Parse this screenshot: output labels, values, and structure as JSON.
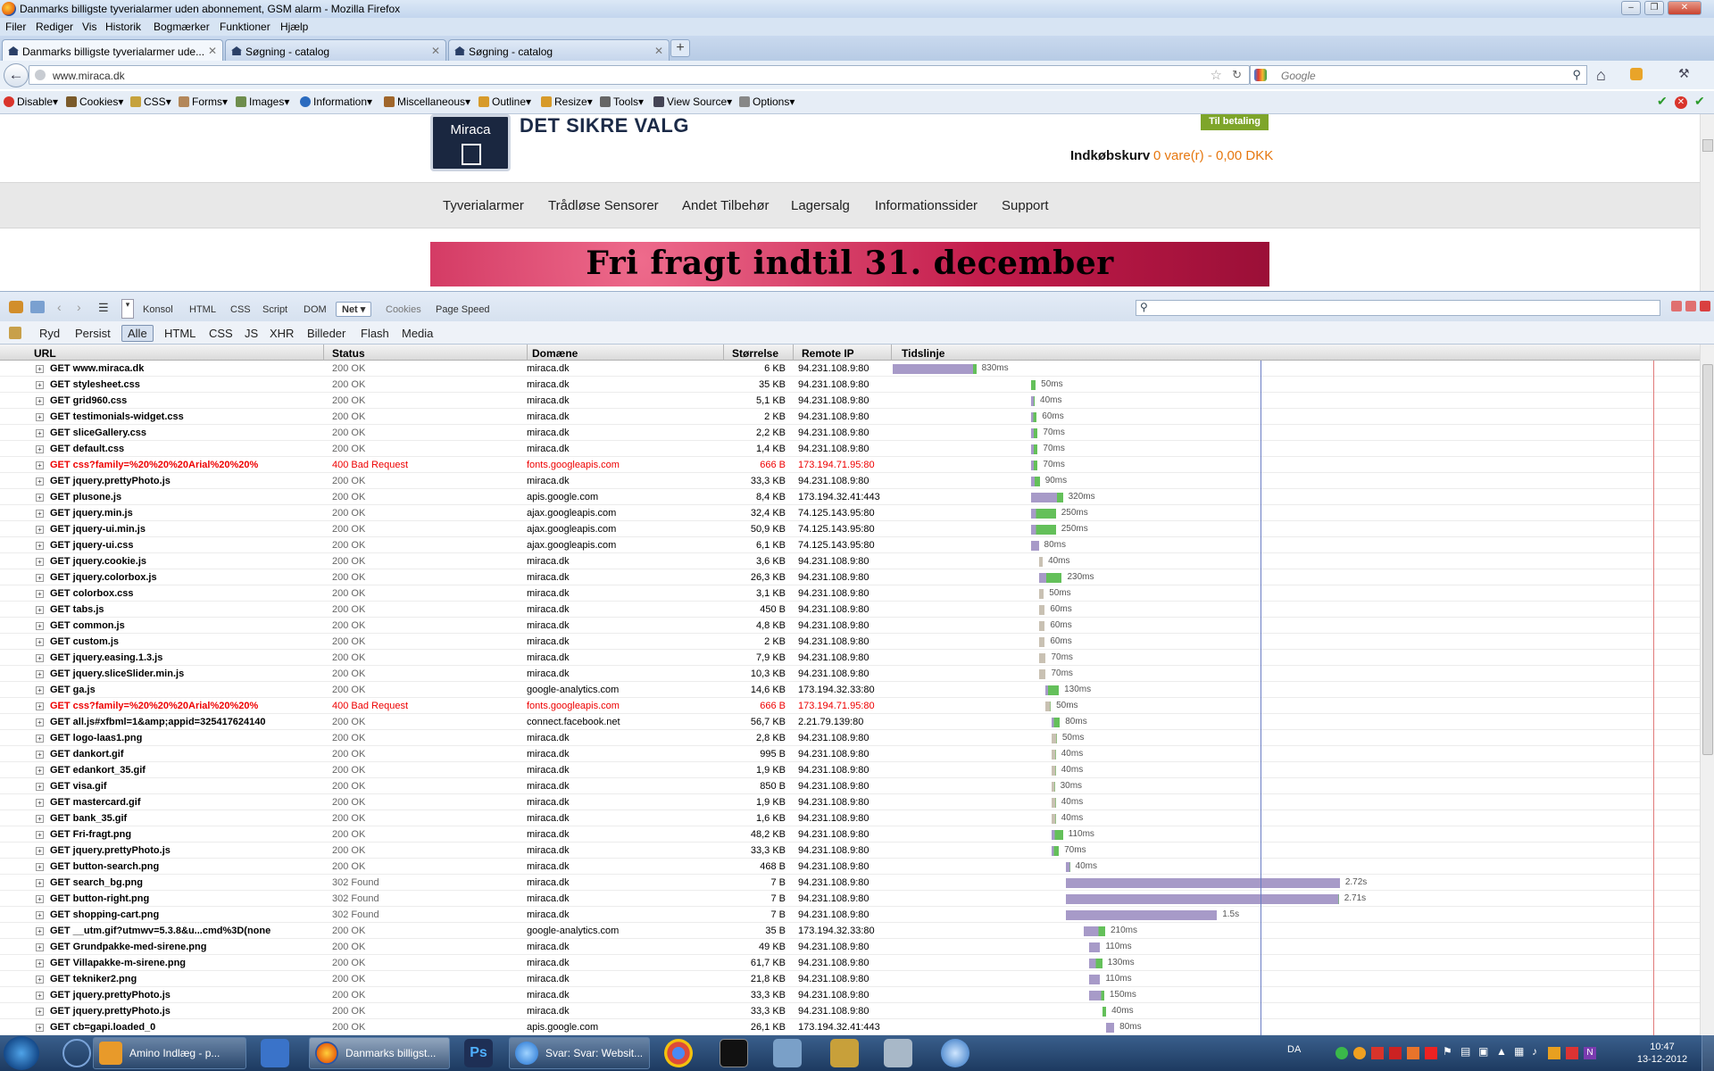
{
  "window": {
    "title": "Danmarks billigste tyverialarmer uden abonnement, GSM alarm - Mozilla Firefox"
  },
  "menu": [
    "Filer",
    "Rediger",
    "Vis",
    "Historik",
    "Bogmærker",
    "Funktioner",
    "Hjælp"
  ],
  "tabs": [
    {
      "label": "Danmarks billigste tyverialarmer ude..."
    },
    {
      "label": "Søgning - catalog"
    },
    {
      "label": "Søgning - catalog"
    }
  ],
  "nav": {
    "url": "www.miraca.dk",
    "search_placeholder": "Google"
  },
  "webdev": [
    "Disable",
    "Cookies",
    "CSS",
    "Forms",
    "Images",
    "Information",
    "Miscellaneous",
    "Outline",
    "Resize",
    "Tools",
    "View Source",
    "Options"
  ],
  "site": {
    "logo_text": "Miraca",
    "slogan": "DET SIKRE VALG",
    "pay_button": "Til betaling",
    "cart_label": "Indkøbskurv",
    "cart_value": "0 vare(r) - 0,00 DKK",
    "menu": [
      "Tyverialarmer",
      "Trådløse Sensorer",
      "Andet Tilbehør",
      "Lagersalg",
      "Informationssider",
      "Support"
    ],
    "banner": "Fri fragt indtil 31. december"
  },
  "firebug": {
    "panels": [
      "Konsol",
      "HTML",
      "CSS",
      "Script",
      "DOM",
      "Net",
      "Cookies",
      "Page Speed"
    ],
    "active_panel": "Net",
    "sub": [
      "Ryd",
      "Persist",
      "Alle",
      "HTML",
      "CSS",
      "JS",
      "XHR",
      "Billeder",
      "Flash",
      "Media"
    ],
    "columns": [
      "URL",
      "Status",
      "Domæne",
      "Størrelse",
      "Remote IP",
      "Tidslinje"
    ],
    "colors": {
      "blocked": "#c9c1b3",
      "waiting": "#a79ac8",
      "receiving": "#64c05a",
      "error": "#e00000"
    },
    "requests": [
      {
        "url": "GET www.miraca.dk",
        "status": "200 OK",
        "domain": "miraca.dk",
        "size": "6 KB",
        "ip": "94.231.108.9:80",
        "time": "830ms",
        "start": 0,
        "dur": 830,
        "recv": 0.04
      },
      {
        "url": "GET stylesheet.css",
        "status": "200 OK",
        "domain": "miraca.dk",
        "size": "35 KB",
        "ip": "94.231.108.9:80",
        "time": "50ms",
        "start": 1370,
        "dur": 50,
        "recv": 1
      },
      {
        "url": "GET grid960.css",
        "status": "200 OK",
        "domain": "miraca.dk",
        "size": "5,1 KB",
        "ip": "94.231.108.9:80",
        "time": "40ms",
        "start": 1370,
        "dur": 40,
        "recv": 0.3
      },
      {
        "url": "GET testimonials-widget.css",
        "status": "200 OK",
        "domain": "miraca.dk",
        "size": "2 KB",
        "ip": "94.231.108.9:80",
        "time": "60ms",
        "start": 1370,
        "dur": 60,
        "recv": 0.6
      },
      {
        "url": "GET sliceGallery.css",
        "status": "200 OK",
        "domain": "miraca.dk",
        "size": "2,2 KB",
        "ip": "94.231.108.9:80",
        "time": "70ms",
        "start": 1370,
        "dur": 70,
        "recv": 0.6
      },
      {
        "url": "GET default.css",
        "status": "200 OK",
        "domain": "miraca.dk",
        "size": "1,4 KB",
        "ip": "94.231.108.9:80",
        "time": "70ms",
        "start": 1370,
        "dur": 70,
        "recv": 0.6
      },
      {
        "url": "GET css?family=%20%20%20Arial%20%20%",
        "status": "400 Bad Request",
        "domain": "fonts.googleapis.com",
        "size": "666 B",
        "ip": "173.194.71.95:80",
        "time": "70ms",
        "start": 1370,
        "dur": 70,
        "recv": 0.6,
        "error": true
      },
      {
        "url": "GET jquery.prettyPhoto.js",
        "status": "200 OK",
        "domain": "miraca.dk",
        "size": "33,3 KB",
        "ip": "94.231.108.9:80",
        "time": "90ms",
        "start": 1370,
        "dur": 90,
        "recv": 0.6
      },
      {
        "url": "GET plusone.js",
        "status": "200 OK",
        "domain": "apis.google.com",
        "size": "8,4 KB",
        "ip": "173.194.32.41:443",
        "time": "320ms",
        "start": 1370,
        "dur": 320,
        "recv": 0.2
      },
      {
        "url": "GET jquery.min.js",
        "status": "200 OK",
        "domain": "ajax.googleapis.com",
        "size": "32,4 KB",
        "ip": "74.125.143.95:80",
        "time": "250ms",
        "start": 1370,
        "dur": 250,
        "recv": 0.8
      },
      {
        "url": "GET jquery-ui.min.js",
        "status": "200 OK",
        "domain": "ajax.googleapis.com",
        "size": "50,9 KB",
        "ip": "74.125.143.95:80",
        "time": "250ms",
        "start": 1370,
        "dur": 250,
        "recv": 0.8
      },
      {
        "url": "GET jquery-ui.css",
        "status": "200 OK",
        "domain": "ajax.googleapis.com",
        "size": "6,1 KB",
        "ip": "74.125.143.95:80",
        "time": "80ms",
        "start": 1370,
        "dur": 80,
        "recv": 0
      },
      {
        "url": "GET jquery.cookie.js",
        "status": "200 OK",
        "domain": "miraca.dk",
        "size": "3,6 KB",
        "ip": "94.231.108.9:80",
        "time": "40ms",
        "start": 1450,
        "dur": 40,
        "recv": 0
      },
      {
        "url": "GET jquery.colorbox.js",
        "status": "200 OK",
        "domain": "miraca.dk",
        "size": "26,3 KB",
        "ip": "94.231.108.9:80",
        "time": "230ms",
        "start": 1450,
        "dur": 230,
        "recv": 0.7
      },
      {
        "url": "GET colorbox.css",
        "status": "200 OK",
        "domain": "miraca.dk",
        "size": "3,1 KB",
        "ip": "94.231.108.9:80",
        "time": "50ms",
        "start": 1450,
        "dur": 50,
        "recv": 0
      },
      {
        "url": "GET tabs.js",
        "status": "200 OK",
        "domain": "miraca.dk",
        "size": "450 B",
        "ip": "94.231.108.9:80",
        "time": "60ms",
        "start": 1450,
        "dur": 60,
        "recv": 0
      },
      {
        "url": "GET common.js",
        "status": "200 OK",
        "domain": "miraca.dk",
        "size": "4,8 KB",
        "ip": "94.231.108.9:80",
        "time": "60ms",
        "start": 1450,
        "dur": 60,
        "recv": 0
      },
      {
        "url": "GET custom.js",
        "status": "200 OK",
        "domain": "miraca.dk",
        "size": "2 KB",
        "ip": "94.231.108.9:80",
        "time": "60ms",
        "start": 1450,
        "dur": 60,
        "recv": 0
      },
      {
        "url": "GET jquery.easing.1.3.js",
        "status": "200 OK",
        "domain": "miraca.dk",
        "size": "7,9 KB",
        "ip": "94.231.108.9:80",
        "time": "70ms",
        "start": 1450,
        "dur": 70,
        "recv": 0
      },
      {
        "url": "GET jquery.sliceSlider.min.js",
        "status": "200 OK",
        "domain": "miraca.dk",
        "size": "10,3 KB",
        "ip": "94.231.108.9:80",
        "time": "70ms",
        "start": 1450,
        "dur": 70,
        "recv": 0
      },
      {
        "url": "GET ga.js",
        "status": "200 OK",
        "domain": "google-analytics.com",
        "size": "14,6 KB",
        "ip": "173.194.32.33:80",
        "time": "130ms",
        "start": 1520,
        "dur": 130,
        "recv": 0.8
      },
      {
        "url": "GET css?family=%20%20%20Arial%20%20%",
        "status": "400 Bad Request",
        "domain": "fonts.googleapis.com",
        "size": "666 B",
        "ip": "173.194.71.95:80",
        "time": "50ms",
        "start": 1520,
        "dur": 50,
        "recv": 0,
        "error": true
      },
      {
        "url": "GET all.js#xfbml=1&amp;appid=325417624140",
        "status": "200 OK",
        "domain": "connect.facebook.net",
        "size": "56,7 KB",
        "ip": "2.21.79.139:80",
        "time": "80ms",
        "start": 1580,
        "dur": 80,
        "recv": 0.7
      },
      {
        "url": "GET logo-laas1.png",
        "status": "200 OK",
        "domain": "miraca.dk",
        "size": "2,8 KB",
        "ip": "94.231.108.9:80",
        "time": "50ms",
        "start": 1580,
        "dur": 50,
        "recv": 0
      },
      {
        "url": "GET dankort.gif",
        "status": "200 OK",
        "domain": "miraca.dk",
        "size": "995 B",
        "ip": "94.231.108.9:80",
        "time": "40ms",
        "start": 1580,
        "dur": 40,
        "recv": 0
      },
      {
        "url": "GET edankort_35.gif",
        "status": "200 OK",
        "domain": "miraca.dk",
        "size": "1,9 KB",
        "ip": "94.231.108.9:80",
        "time": "40ms",
        "start": 1580,
        "dur": 40,
        "recv": 0
      },
      {
        "url": "GET visa.gif",
        "status": "200 OK",
        "domain": "miraca.dk",
        "size": "850 B",
        "ip": "94.231.108.9:80",
        "time": "30ms",
        "start": 1580,
        "dur": 30,
        "recv": 0
      },
      {
        "url": "GET mastercard.gif",
        "status": "200 OK",
        "domain": "miraca.dk",
        "size": "1,9 KB",
        "ip": "94.231.108.9:80",
        "time": "40ms",
        "start": 1580,
        "dur": 40,
        "recv": 0
      },
      {
        "url": "GET bank_35.gif",
        "status": "200 OK",
        "domain": "miraca.dk",
        "size": "1,6 KB",
        "ip": "94.231.108.9:80",
        "time": "40ms",
        "start": 1580,
        "dur": 40,
        "recv": 0
      },
      {
        "url": "GET Fri-fragt.png",
        "status": "200 OK",
        "domain": "miraca.dk",
        "size": "48,2 KB",
        "ip": "94.231.108.9:80",
        "time": "110ms",
        "start": 1580,
        "dur": 110,
        "recv": 0.7
      },
      {
        "url": "GET jquery.prettyPhoto.js",
        "status": "200 OK",
        "domain": "miraca.dk",
        "size": "33,3 KB",
        "ip": "94.231.108.9:80",
        "time": "70ms",
        "start": 1580,
        "dur": 70,
        "recv": 0.7
      },
      {
        "url": "GET button-search.png",
        "status": "200 OK",
        "domain": "miraca.dk",
        "size": "468 B",
        "ip": "94.231.108.9:80",
        "time": "40ms",
        "start": 1720,
        "dur": 40,
        "recv": 0
      },
      {
        "url": "GET search_bg.png",
        "status": "302 Found",
        "domain": "miraca.dk",
        "size": "7 B",
        "ip": "94.231.108.9:80",
        "time": "2.72s",
        "start": 1720,
        "dur": 2720,
        "recv": 0
      },
      {
        "url": "GET button-right.png",
        "status": "302 Found",
        "domain": "miraca.dk",
        "size": "7 B",
        "ip": "94.231.108.9:80",
        "time": "2.71s",
        "start": 1720,
        "dur": 2710,
        "recv": 0
      },
      {
        "url": "GET shopping-cart.png",
        "status": "302 Found",
        "domain": "miraca.dk",
        "size": "7 B",
        "ip": "94.231.108.9:80",
        "time": "1.5s",
        "start": 1720,
        "dur": 1500,
        "recv": 0
      },
      {
        "url": "GET __utm.gif?utmwv=5.3.8&u...cmd%3D(none",
        "status": "200 OK",
        "domain": "google-analytics.com",
        "size": "35 B",
        "ip": "173.194.32.33:80",
        "time": "210ms",
        "start": 1900,
        "dur": 210,
        "recv": 0.3
      },
      {
        "url": "GET Grundpakke-med-sirene.png",
        "status": "200 OK",
        "domain": "miraca.dk",
        "size": "49 KB",
        "ip": "94.231.108.9:80",
        "time": "110ms",
        "start": 1950,
        "dur": 110,
        "recv": 0
      },
      {
        "url": "GET Villapakke-m-sirene.png",
        "status": "200 OK",
        "domain": "miraca.dk",
        "size": "61,7 KB",
        "ip": "94.231.108.9:80",
        "time": "130ms",
        "start": 1950,
        "dur": 130,
        "recv": 0.5
      },
      {
        "url": "GET tekniker2.png",
        "status": "200 OK",
        "domain": "miraca.dk",
        "size": "21,8 KB",
        "ip": "94.231.108.9:80",
        "time": "110ms",
        "start": 1950,
        "dur": 110,
        "recv": 0
      },
      {
        "url": "GET jquery.prettyPhoto.js",
        "status": "200 OK",
        "domain": "miraca.dk",
        "size": "33,3 KB",
        "ip": "94.231.108.9:80",
        "time": "150ms",
        "start": 1950,
        "dur": 150,
        "recv": 0.2
      },
      {
        "url": "GET jquery.prettyPhoto.js",
        "status": "200 OK",
        "domain": "miraca.dk",
        "size": "33,3 KB",
        "ip": "94.231.108.9:80",
        "time": "40ms",
        "start": 2080,
        "dur": 40,
        "recv": 1
      },
      {
        "url": "GET cb=gapi.loaded_0",
        "status": "200 OK",
        "domain": "apis.google.com",
        "size": "26,1 KB",
        "ip": "173.194.32.41:443",
        "time": "80ms",
        "start": 2120,
        "dur": 80,
        "recv": 0
      }
    ]
  },
  "taskbar": {
    "tasks": [
      "Amino Indlæg - p...",
      "Danmarks billigst...",
      "Svar: Svar: Websit..."
    ],
    "lang": "DA",
    "time": "10:47",
    "date": "13-12-2012"
  }
}
